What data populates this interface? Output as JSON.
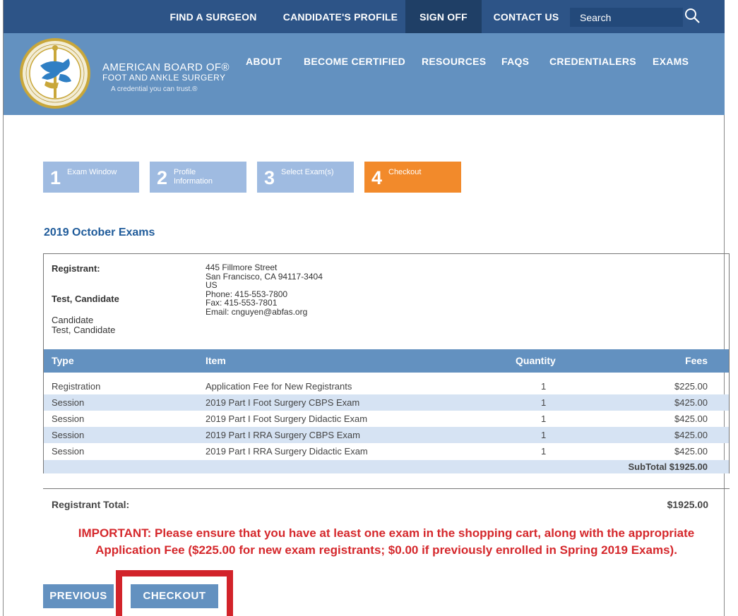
{
  "topnav": {
    "find_surgeon": "FIND A SURGEON",
    "candidate_profile": "CANDIDATE'S PROFILE",
    "sign_off": "SIGN OFF",
    "contact_us": "CONTACT US",
    "search_placeholder": "Search"
  },
  "brand": {
    "line1": "AMERICAN BOARD OF®",
    "line2": "FOOT AND ANKLE SURGERY",
    "tagline": "A credential you can trust.®"
  },
  "mainnav": {
    "about": "ABOUT",
    "become_certified": "BECOME CERTIFIED",
    "resources": "RESOURCES",
    "faqs": "FAQS",
    "credentialers": "CREDENTIALERS",
    "exams": "EXAMS"
  },
  "steps": [
    {
      "num": "1",
      "label": "Exam Window"
    },
    {
      "num": "2",
      "label": "Profile Information"
    },
    {
      "num": "3",
      "label": "Select Exam(s)"
    },
    {
      "num": "4",
      "label": "Checkout"
    }
  ],
  "exam_title": "2019 October Exams",
  "registrant": {
    "label": "Registrant:",
    "name": "Test, Candidate",
    "role": "Candidate",
    "name2": "Test, Candidate",
    "address_line1": "445 Fillmore Street",
    "address_line2": "San Francisco, CA 94117-3404",
    "address_line3": "US",
    "phone": "Phone: 415-553-7800",
    "fax": "Fax: 415-553-7801",
    "email": "Email: cnguyen@abfas.org"
  },
  "table": {
    "headers": {
      "type": "Type",
      "item": "Item",
      "quantity": "Quantity",
      "fees": "Fees"
    },
    "rows": [
      {
        "type": "Registration",
        "item": "Application Fee for New Registrants",
        "qty": "1",
        "fee": "$225.00"
      },
      {
        "type": "Session",
        "item": "2019 Part I Foot Surgery CBPS Exam",
        "qty": "1",
        "fee": "$425.00"
      },
      {
        "type": "Session",
        "item": "2019 Part I Foot Surgery Didactic Exam",
        "qty": "1",
        "fee": "$425.00"
      },
      {
        "type": "Session",
        "item": "2019 Part I RRA Surgery CBPS Exam",
        "qty": "1",
        "fee": "$425.00"
      },
      {
        "type": "Session",
        "item": "2019 Part I RRA Surgery Didactic Exam",
        "qty": "1",
        "fee": "$425.00"
      }
    ],
    "subtotal": "SubTotal $1925.00"
  },
  "total": {
    "label": "Registrant Total:",
    "value": "$1925.00"
  },
  "important": {
    "line1": "IMPORTANT: Please ensure that you have at least one exam in the shopping cart, along with the appropriate",
    "line2": "Application Fee ($225.00 for new exam registrants; $0.00 if previously enrolled in Spring 2019 Exams)."
  },
  "buttons": {
    "previous": "PREVIOUS",
    "checkout": "CHECKOUT"
  },
  "colors": {
    "topbar": "#2d5487",
    "header": "#6391c0",
    "step_inactive": "#9fbbe1",
    "step_active": "#f28a2b",
    "important_text": "#d5282c",
    "highlight": "#d2232a"
  }
}
